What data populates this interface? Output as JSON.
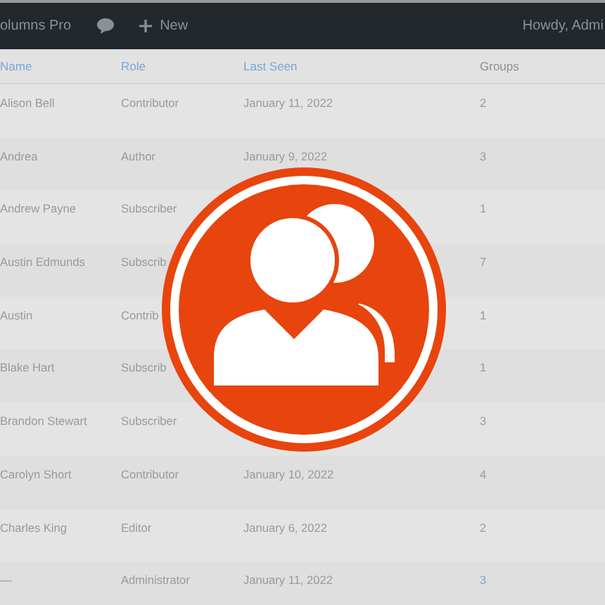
{
  "admin_bar": {
    "site_name": "olumns Pro",
    "new_label": "New",
    "greeting": "Howdy, Admi"
  },
  "table": {
    "columns": [
      {
        "label": "Name",
        "sortable": true
      },
      {
        "label": "Role",
        "sortable": true
      },
      {
        "label": "Last Seen",
        "sortable": true
      },
      {
        "label": "Groups",
        "sortable": false
      }
    ],
    "rows": [
      {
        "name": "Alison Bell",
        "role": "Contributor",
        "last_seen": "January 11, 2022",
        "groups": "2",
        "groups_link": false
      },
      {
        "name": "Andrea",
        "role": "Author",
        "last_seen": "January 9, 2022",
        "groups": "3",
        "groups_link": false
      },
      {
        "name": "Andrew Payne",
        "role": "Subscriber",
        "groups": "1",
        "groups_link": false
      },
      {
        "name": "Austin Edmunds",
        "role": "Subscrib",
        "groups": "7",
        "groups_link": false
      },
      {
        "name": "Austin",
        "role": "Contrib",
        "groups": "1",
        "groups_link": false
      },
      {
        "name": "Blake Hart",
        "role": "Subscrib",
        "groups": "1",
        "groups_link": false
      },
      {
        "name": "Brandon Stewart",
        "role": "Subscriber",
        "groups": "3",
        "groups_link": false
      },
      {
        "name": "Carolyn Short",
        "role": "Contributor",
        "last_seen": "January 10, 2022",
        "groups": "4",
        "groups_link": false
      },
      {
        "name": "Charles King",
        "role": "Editor",
        "last_seen": "January 6, 2022",
        "groups": "2",
        "groups_link": false
      },
      {
        "name": "—",
        "role": "Administrator",
        "last_seen": "January 11, 2022",
        "groups": "3",
        "groups_link": true
      }
    ]
  }
}
